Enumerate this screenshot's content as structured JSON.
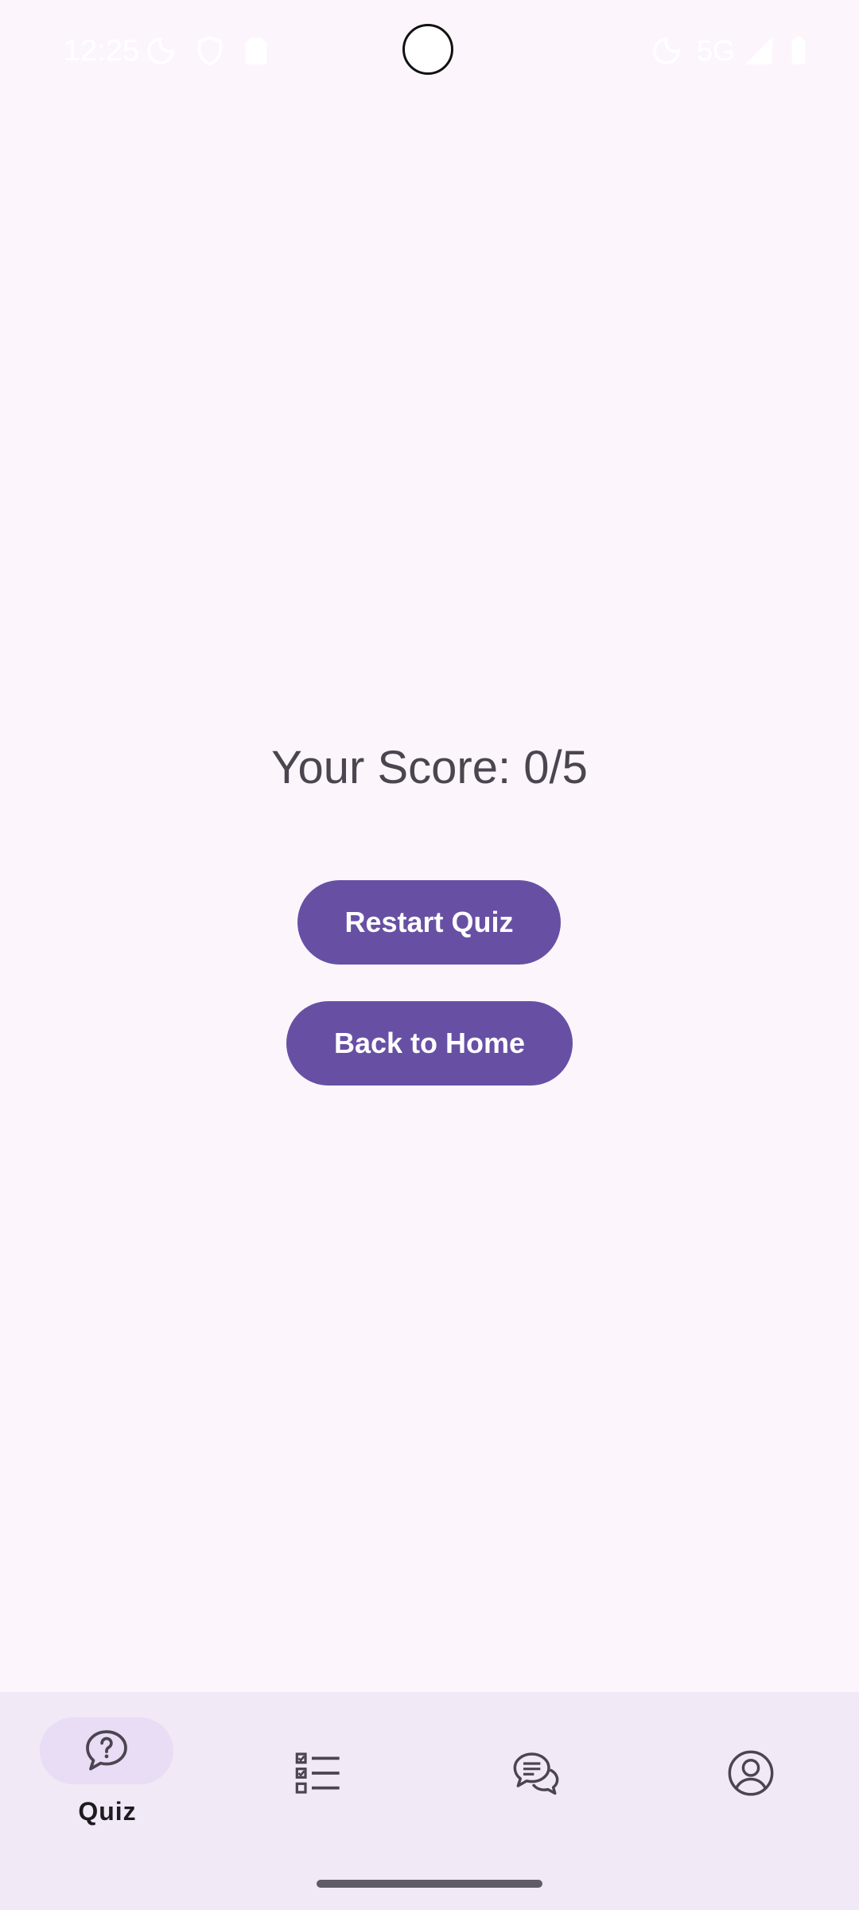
{
  "status_bar": {
    "time": "12:25",
    "network": "5G"
  },
  "result": {
    "score_text": "Your Score: 0/5"
  },
  "actions": {
    "restart_label": "Restart Quiz",
    "home_label": "Back to Home"
  },
  "bottom_nav": {
    "items": [
      {
        "label": "Quiz",
        "icon": "quiz-bubble-icon",
        "selected": true
      },
      {
        "label": "",
        "icon": "checklist-icon",
        "selected": false
      },
      {
        "label": "",
        "icon": "chat-icon",
        "selected": false
      },
      {
        "label": "",
        "icon": "profile-icon",
        "selected": false
      }
    ]
  },
  "colors": {
    "background": "#fcf6fc",
    "primary": "#6750a4",
    "nav_background": "#f1e9f5",
    "nav_indicator": "#e8ddf5",
    "text": "#4a454f"
  }
}
